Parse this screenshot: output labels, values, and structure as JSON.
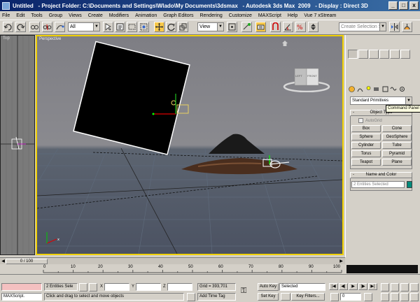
{
  "window": {
    "title": "Untitled   - Project Folder: C:\\Documents and Settings\\Wlado\\My Documents\\3dsmax   - Autodesk 3ds Max  2009   - Display : Direct 3D",
    "controls": [
      "_",
      "□",
      "x"
    ]
  },
  "menu": [
    "File",
    "Edit",
    "Tools",
    "Group",
    "Views",
    "Create",
    "Modifiers",
    "Animation",
    "Graph Editors",
    "Rendering",
    "Customize",
    "MAXScript",
    "Help",
    "Vue 7 xStream"
  ],
  "toolbar": {
    "selection_filter": "All",
    "reference_coord": "View",
    "named_selection_placeholder": "Create Selection Set"
  },
  "viewports": {
    "left_label": "Top",
    "main_label": "Perspective",
    "viewcube": {
      "left": "LEFT",
      "front": "FRONT"
    }
  },
  "command_panel": {
    "category": "Standard Primitives",
    "object_type_title": "Object Type",
    "autogrid": "AutoGrid",
    "buttons": [
      "Box",
      "Cone",
      "Sphere",
      "GeoSphere",
      "Cylinder",
      "Tube",
      "Torus",
      "Pyramid",
      "Teapot",
      "Plane"
    ],
    "tooltip": "Command Panel",
    "name_color_title": "Name and Color",
    "name_value": "2 Entities Selected",
    "swatch_color": "#008a7a",
    "rollout_sign": "-"
  },
  "timeline": {
    "frame_label": "0 / 100",
    "ticks": [
      "0",
      "10",
      "20",
      "30",
      "40",
      "50",
      "60",
      "70",
      "80",
      "90",
      "100"
    ]
  },
  "status": {
    "maxscript": "MAXScript.",
    "selection_info": "2 Entities Sele",
    "x_label": "X",
    "y_label": "Y",
    "z_label": "Z",
    "grid": "Grid = 393,701",
    "prompt": "Click and drag to select and move objects",
    "add_time_tag": "Add Time Tag",
    "auto_key": "Auto Key",
    "set_key": "Set Key",
    "key_mode": "Selected",
    "key_filters": "Key Filters...",
    "frame": "0"
  }
}
